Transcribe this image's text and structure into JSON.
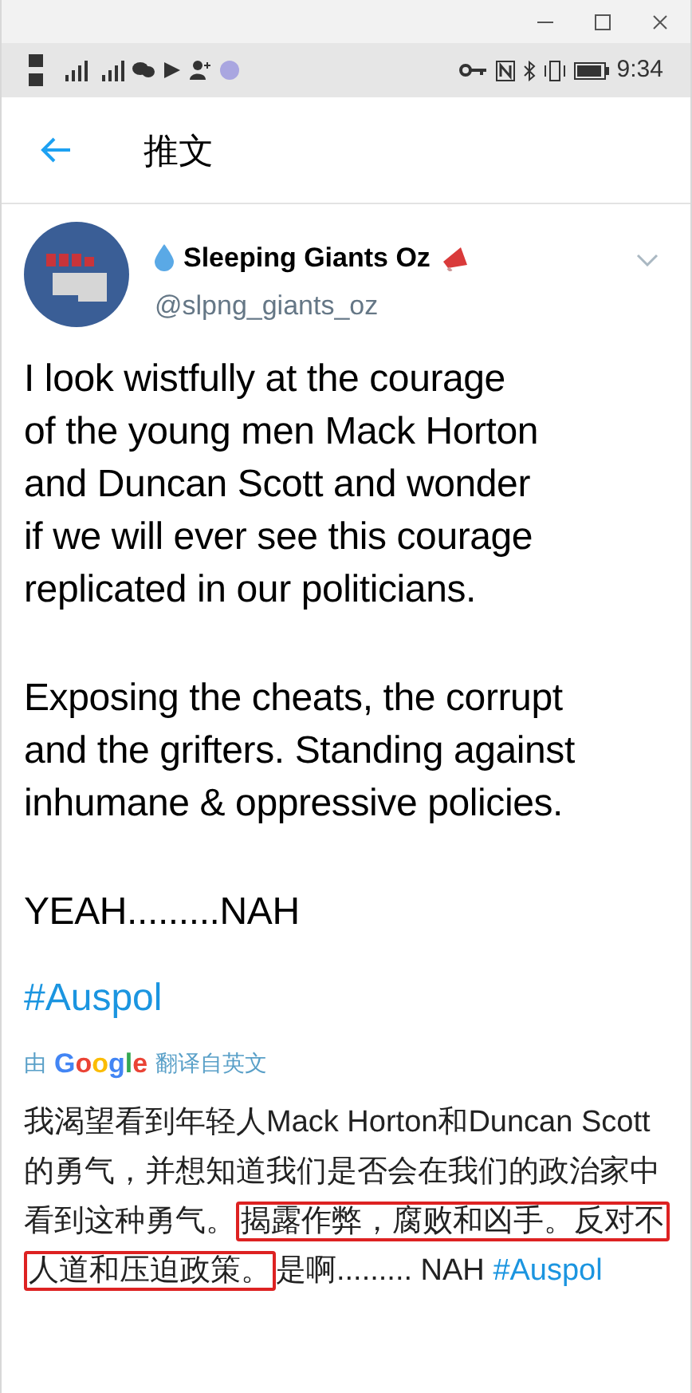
{
  "status_bar": {
    "time": "9:34"
  },
  "header": {
    "title": "推文"
  },
  "tweet": {
    "name": "Sleeping Giants Oz",
    "handle": "@slpng_giants_oz",
    "paragraphs": [
      "I look wistfully at the courage\nof the young men Mack Horton\nand Duncan Scott and wonder\nif we will ever see this courage\nreplicated in our politicians.",
      "Exposing the cheats, the corrupt\nand the grifters. Standing against\ninhumane & oppressive policies.",
      "YEAH.........NAH"
    ],
    "hashtag": "#Auspol",
    "translation": {
      "by": "由",
      "provider": "Google",
      "label": "翻译自英文",
      "segments": [
        {
          "text": "我渴望看到年轻人Mack Horton和Duncan Scott的勇气，并想知道我们是否会在我们的政治家中看到这种勇气。",
          "highlighted": false
        },
        {
          "text": "揭露作弊，腐败和凶手。反对不人道和压迫政策。",
          "highlighted": true
        },
        {
          "text": "是啊......... NAH ",
          "highlighted": false
        }
      ],
      "hashtag": "#Auspol"
    }
  }
}
